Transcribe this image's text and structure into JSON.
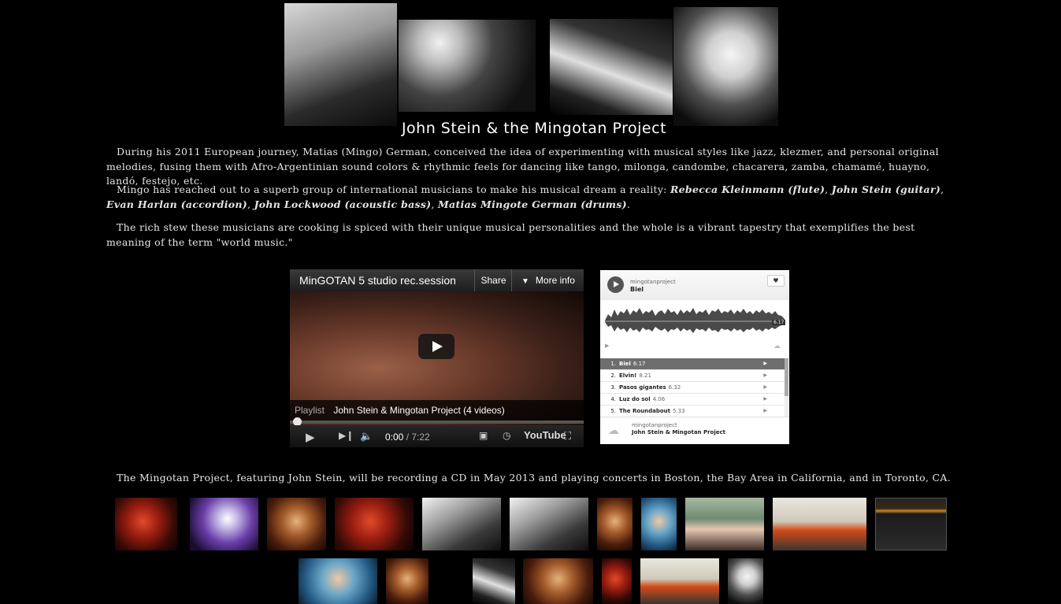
{
  "header": {
    "site_title": "John Stein & the Mingotan Project"
  },
  "intro": {
    "p1": "During his 2011 European journey, Matias (Mingo) German, conceived the idea of experimenting with musical styles like jazz, klezmer, and personal original melodies, fusing them with Afro-Argentinian sound colors & rhythmic feels for dancing like tango, milonga, candombe, chacarera, zamba, chamamé, huayno, landó, festejo, etc.",
    "p2_prefix": "Mingo has reached out to a superb group of international musicians to make his musical dream a reality: ",
    "musicians": [
      "Rebecca Kleinmann (flute)",
      "John Stein (guitar)",
      "Evan Harlan (accordion)",
      "John Lockwood (acoustic bass)",
      "Matias Mingote German (drums)"
    ],
    "p3": "The rich stew these musicians are cooking is spiced with their unique musical personalities and the whole is a vibrant tapestry that exemplifies the best meaning of the term \"world music.\""
  },
  "video_player": {
    "title": "MinGOTAN 5 studio rec.session",
    "share_label": "Share",
    "more_info_label": "More info",
    "playlist_label": "Playlist",
    "playlist_name": "John Stein & Mingotan Project (4 videos)",
    "current_time": "0:00",
    "duration": "/ 7:22",
    "brand": "YouTube"
  },
  "soundcloud": {
    "user": "mingotanproject",
    "track": "Biel",
    "track_time": "6.17",
    "tracks": [
      {
        "num": "1.",
        "title": "Biel",
        "dur": "6.17"
      },
      {
        "num": "2.",
        "title": "Elvin!",
        "dur": "8.21"
      },
      {
        "num": "3.",
        "title": "Pasos gigantes",
        "dur": "6.32"
      },
      {
        "num": "4.",
        "title": "Luz do sol",
        "dur": "4.06"
      },
      {
        "num": "5.",
        "title": "The Roundabout",
        "dur": "5.33"
      }
    ],
    "footer_user": "mingotanproject",
    "footer_set": "John Stein & Mingotan Project"
  },
  "closing": {
    "text": "The Mingotan Project, featuring John Stein, will be recording a CD in May 2013 and playing concerts in Boston, the Bay Area in California, and in Toronto, CA."
  }
}
